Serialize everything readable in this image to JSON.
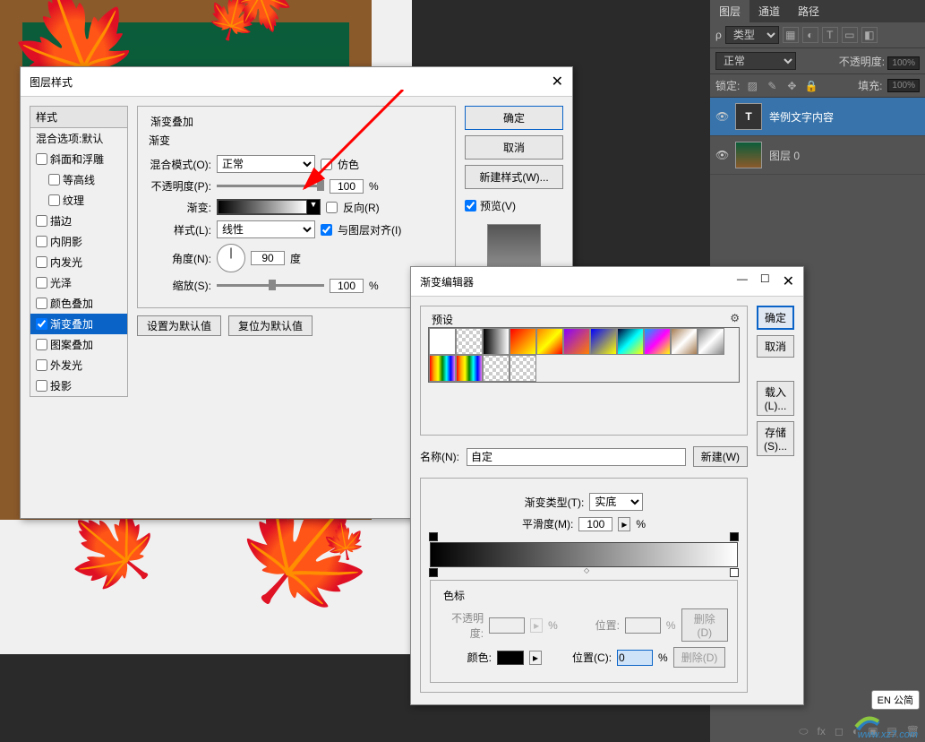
{
  "canvas": {},
  "layers_panel": {
    "tabs": [
      "图层",
      "通道",
      "路径"
    ],
    "filter_label": "类型",
    "blend_mode": "正常",
    "opacity_label": "不透明度:",
    "opacity_value": "100%",
    "lock_label": "锁定:",
    "fill_label": "填充:",
    "fill_value": "100%",
    "layers": [
      {
        "name": "举例文字内容",
        "thumb": "T"
      },
      {
        "name": "图层 0",
        "thumb": "img"
      }
    ]
  },
  "layer_style": {
    "title": "图层样式",
    "styles_header": "样式",
    "blend_options": "混合选项:默认",
    "effects": [
      {
        "key": "bevel",
        "label": "斜面和浮雕",
        "checked": false
      },
      {
        "key": "contour",
        "label": "等高线",
        "checked": false,
        "indent": true
      },
      {
        "key": "texture",
        "label": "纹理",
        "checked": false,
        "indent": true
      },
      {
        "key": "stroke",
        "label": "描边",
        "checked": false
      },
      {
        "key": "inner_shadow",
        "label": "内阴影",
        "checked": false
      },
      {
        "key": "inner_glow",
        "label": "内发光",
        "checked": false
      },
      {
        "key": "satin",
        "label": "光泽",
        "checked": false
      },
      {
        "key": "color_overlay",
        "label": "颜色叠加",
        "checked": false
      },
      {
        "key": "gradient_overlay",
        "label": "渐变叠加",
        "checked": true,
        "selected": true
      },
      {
        "key": "pattern_overlay",
        "label": "图案叠加",
        "checked": false
      },
      {
        "key": "outer_glow",
        "label": "外发光",
        "checked": false
      },
      {
        "key": "drop_shadow",
        "label": "投影",
        "checked": false
      }
    ],
    "gradient_overlay": {
      "section_title": "渐变叠加",
      "subsection_title": "渐变",
      "blend_mode_label": "混合模式(O):",
      "blend_mode_value": "正常",
      "dither_label": "仿色",
      "opacity_label": "不透明度(P):",
      "opacity_value": "100",
      "pct": "%",
      "gradient_label": "渐变:",
      "reverse_label": "反向(R)",
      "style_label": "样式(L):",
      "style_value": "线性",
      "align_label": "与图层对齐(I)",
      "angle_label": "角度(N):",
      "angle_value": "90",
      "angle_unit": "度",
      "scale_label": "缩放(S):",
      "scale_value": "100",
      "set_default": "设置为默认值",
      "reset_default": "复位为默认值"
    },
    "buttons": {
      "ok": "确定",
      "cancel": "取消",
      "new_style": "新建样式(W)...",
      "preview": "预览(V)"
    }
  },
  "gradient_editor": {
    "title": "渐变编辑器",
    "presets_label": "预设",
    "buttons": {
      "ok": "确定",
      "cancel": "取消",
      "load": "载入(L)...",
      "save": "存储(S)...",
      "new": "新建(W)"
    },
    "name_label": "名称(N):",
    "name_value": "自定",
    "type_label": "渐变类型(T):",
    "type_value": "实底",
    "smoothness_label": "平滑度(M):",
    "smoothness_value": "100",
    "pct": "%",
    "stops_label": "色标",
    "opacity_stop_label": "不透明度:",
    "location_label": "位置:",
    "location_c_label": "位置(C):",
    "location_value": "0",
    "color_label": "颜色:",
    "delete_label": "删除(D)"
  },
  "ime": "EN 公简",
  "watermark": "www.xz7.com"
}
